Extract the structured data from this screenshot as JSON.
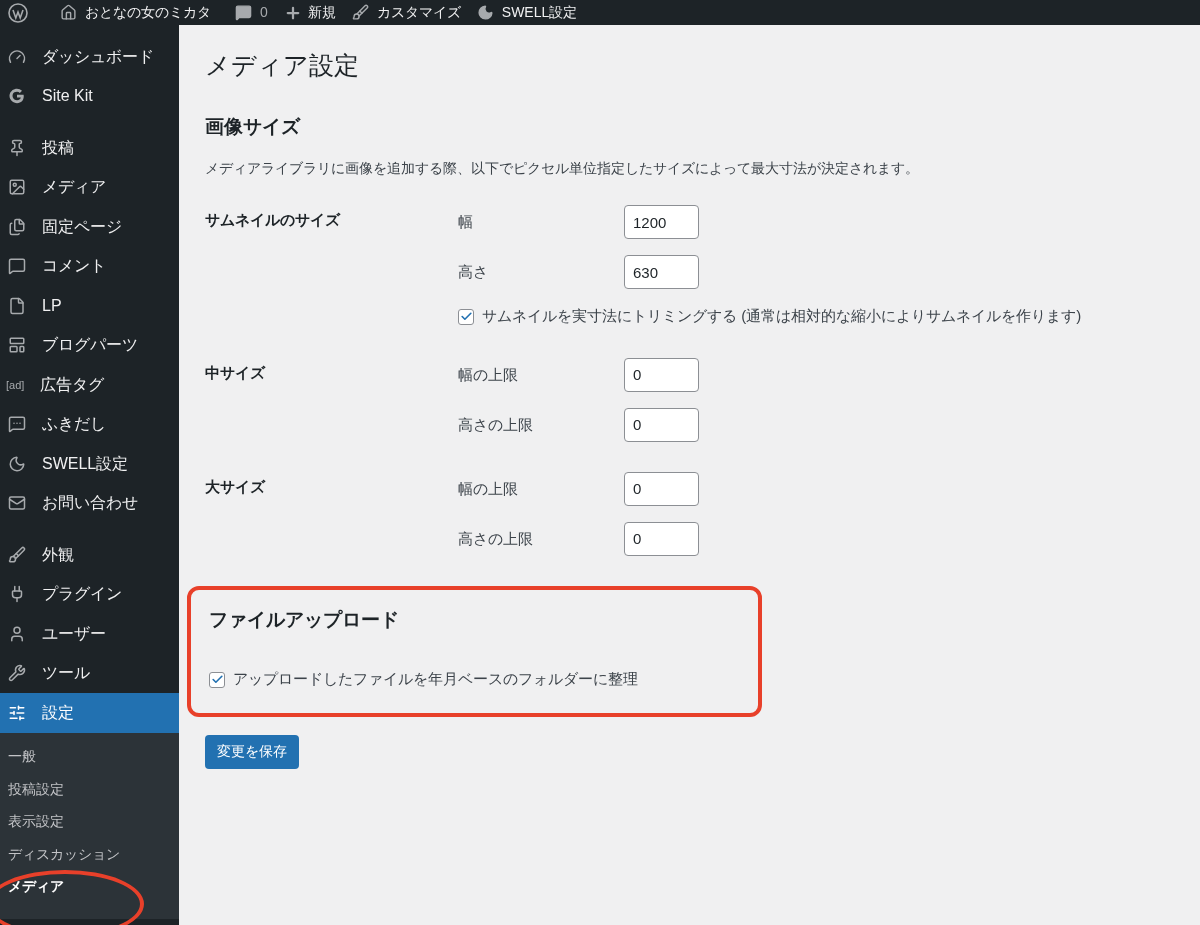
{
  "admin_bar": {
    "site": "おとなの女のミカタ",
    "comments": "0",
    "new": "新規",
    "customize": "カスタマイズ",
    "swell": "SWELL設定"
  },
  "sidebar": {
    "menu_groups": [
      [
        {
          "label": "ダッシュボード",
          "selected": false
        },
        {
          "label": "Site Kit",
          "selected": false
        }
      ],
      [
        {
          "label": "投稿",
          "selected": false
        },
        {
          "label": "メディア",
          "selected": false
        },
        {
          "label": "固定ページ",
          "selected": false
        },
        {
          "label": "コメント",
          "selected": false
        },
        {
          "label": "LP",
          "selected": false
        },
        {
          "label": "ブログパーツ",
          "selected": false
        },
        {
          "label": "広告タグ",
          "icon_text": "[ad]",
          "selected": false
        },
        {
          "label": "ふきだし",
          "selected": false
        },
        {
          "label": "SWELL設定",
          "selected": false
        },
        {
          "label": "お問い合わせ",
          "selected": false
        }
      ],
      [
        {
          "label": "外観",
          "selected": false
        },
        {
          "label": "プラグイン",
          "selected": false
        },
        {
          "label": "ユーザー",
          "selected": false
        },
        {
          "label": "ツール",
          "selected": false
        },
        {
          "label": "設定",
          "selected": true
        }
      ]
    ],
    "submenu": [
      {
        "label": "一般",
        "selected": false
      },
      {
        "label": "投稿設定",
        "selected": false
      },
      {
        "label": "表示設定",
        "selected": false
      },
      {
        "label": "ディスカッション",
        "selected": false
      },
      {
        "label": "メディア",
        "selected": true
      }
    ]
  },
  "content": {
    "title": "メディア設定",
    "image_sizes": {
      "heading": "画像サイズ",
      "description": "メディアライブラリに画像を追加する際、以下でピクセル単位指定したサイズによって最大寸法が決定されます。",
      "rows": [
        {
          "label": "サムネイルのサイズ",
          "fields": [
            {
              "label": "幅",
              "value": "1200"
            },
            {
              "label": "高さ",
              "value": "630"
            }
          ],
          "checkbox": {
            "label": "サムネイルを実寸法にトリミングする (通常は相対的な縮小によりサムネイルを作ります)",
            "checked": true
          }
        },
        {
          "label": "中サイズ",
          "fields": [
            {
              "label": "幅の上限",
              "value": "0"
            },
            {
              "label": "高さの上限",
              "value": "0"
            }
          ]
        },
        {
          "label": "大サイズ",
          "fields": [
            {
              "label": "幅の上限",
              "value": "0"
            },
            {
              "label": "高さの上限",
              "value": "0"
            }
          ]
        }
      ]
    },
    "file_upload": {
      "heading": "ファイルアップロード",
      "highlighted": true,
      "checkbox": {
        "label": "アップロードしたファイルを年月ベースのフォルダーに整理",
        "checked": true
      }
    },
    "save_button": "変更を保存"
  }
}
